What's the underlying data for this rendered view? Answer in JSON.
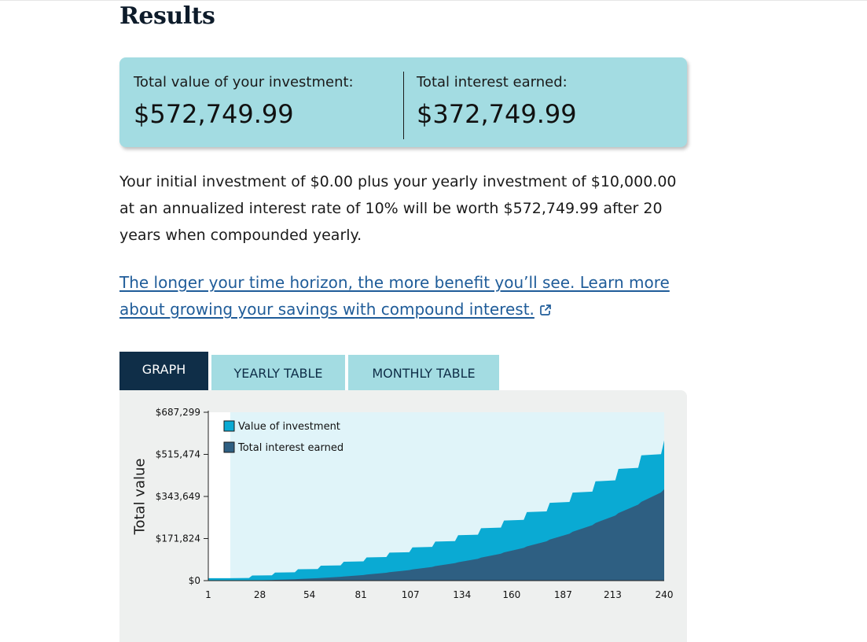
{
  "page": {
    "title": "Results"
  },
  "summary": {
    "total_value_label": "Total value of your investment:",
    "total_value": "$572,749.99",
    "total_interest_label": "Total interest earned:",
    "total_interest": "$372,749.99"
  },
  "description": "Your initial investment of $0.00 plus your yearly investment of $10,000.00 at an annualized interest rate of 10% will be worth $572,749.99 after 20 years when compounded yearly.",
  "link": {
    "text": "The longer your time horizon, the more benefit you’ll see. Learn more about growing your savings with compound interest.",
    "icon": "external-link-icon"
  },
  "tabs": [
    {
      "label": "GRAPH",
      "active": true
    },
    {
      "label": "YEARLY TABLE",
      "active": false
    },
    {
      "label": "MONTHLY TABLE",
      "active": false
    }
  ],
  "colors": {
    "card_bg": "#a3dce2",
    "tab_active": "#0f2e48",
    "value_series": "#0aaad3",
    "interest_series": "#2e5f82",
    "plot_bg": "#e0f4f9",
    "link": "#1f5c99"
  },
  "chart_data": {
    "type": "area",
    "ylabel": "Total value",
    "xlabel": "",
    "x_ticks": [
      1,
      28,
      54,
      81,
      107,
      134,
      160,
      187,
      213,
      240
    ],
    "y_ticks": [
      "$0",
      "$171,824",
      "$343,649",
      "$515,474",
      "$687,299"
    ],
    "ylim": [
      0,
      687299
    ],
    "xlim": [
      1,
      240
    ],
    "legend_placement": "top-left",
    "series": [
      {
        "name": "Value of investment",
        "color": "#0aaad3",
        "note_values": "month-end value, yearly contribution of 10000 compounded yearly at 10%",
        "months": [
          1,
          12,
          24,
          36,
          48,
          60,
          72,
          84,
          96,
          108,
          120,
          132,
          144,
          156,
          168,
          180,
          192,
          204,
          216,
          228,
          240
        ],
        "values": [
          10000,
          10000,
          21000,
          33100,
          46410,
          61051,
          77156,
          94872,
          114359,
          135795,
          159374,
          185312,
          213843,
          245227,
          279750,
          317725,
          359497,
          405447,
          455992,
          511591,
          572750
        ]
      },
      {
        "name": "Total interest earned",
        "color": "#2e5f82",
        "months": [
          1,
          12,
          24,
          36,
          48,
          60,
          72,
          84,
          96,
          108,
          120,
          132,
          144,
          156,
          168,
          180,
          192,
          204,
          216,
          228,
          240
        ],
        "values": [
          0,
          0,
          1000,
          3100,
          6410,
          11051,
          17156,
          24872,
          34359,
          45795,
          59374,
          75312,
          93843,
          115227,
          139750,
          167725,
          199497,
          235447,
          275992,
          321591,
          372750
        ]
      }
    ]
  }
}
